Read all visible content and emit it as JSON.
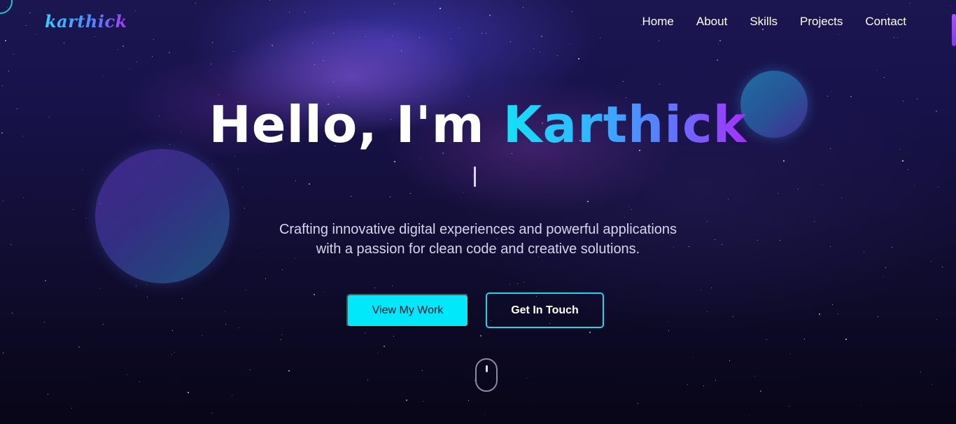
{
  "header": {
    "logo_text": "karthick",
    "nav": [
      {
        "label": "Home"
      },
      {
        "label": "About"
      },
      {
        "label": "Skills"
      },
      {
        "label": "Projects"
      },
      {
        "label": "Contact"
      }
    ]
  },
  "hero": {
    "greeting": "Hello, I'm ",
    "name": "Karthick",
    "tagline_line1": "Crafting innovative digital experiences and powerful applications",
    "tagline_line2": "with a passion for clean code and creative solutions.",
    "primary_button": "View My Work",
    "secondary_button": "Get In Touch"
  },
  "colors": {
    "accent_cyan": "#00e8fa",
    "accent_purple": "#a72fff",
    "background": "#0b0820"
  },
  "icons": {
    "scroll_indicator": "mouse-scroll-icon"
  }
}
